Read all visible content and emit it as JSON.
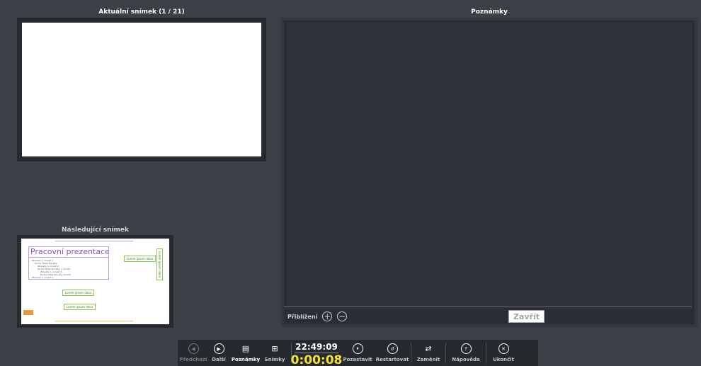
{
  "current_slide": {
    "title": "Aktuální snímek (1 / 21)"
  },
  "next_slide": {
    "title": "Následující snímek",
    "thumb_title": "Pracovní prezentace",
    "thumb_body_lines": [
      "Zkouška ↳ úroveň 1",
      "Druhý řádek zkoušky",
      "Zkouška ↳ úroveň 2",
      "Druhý řádek zkoušky ↳ úroveň",
      "Zkouška ↳ úroveň 3",
      "Druhý řádek zkoušky úroveň",
      "Zkouška ↳ úroveň 1"
    ],
    "callouts": [
      "Lorem ipsum dolor",
      "Lorem ipsum dolor",
      "Lorem ipsum dolor",
      "Lorem ipsum dolor"
    ]
  },
  "notes": {
    "title": "Poznámky",
    "zoom_label": "Přiblížení",
    "zoom_in_symbol": "+",
    "zoom_out_symbol": "−",
    "close_label": "Zavřít"
  },
  "toolbar": {
    "prev": {
      "label": "Předchozí",
      "icon": "◀"
    },
    "next": {
      "label": "Další",
      "icon": "▶"
    },
    "notes": {
      "label": "Poznámky",
      "icon": "▤"
    },
    "slides": {
      "label": "Snímky",
      "icon": "⊞"
    },
    "clock": "22:49:09",
    "timer": "0:00:08",
    "pause": {
      "label": "Pozastavit",
      "icon": "⏸"
    },
    "restart": {
      "label": "Restartovat",
      "icon": "↺"
    },
    "swap": {
      "label": "Zaměnit",
      "icon": "⇄"
    },
    "help": {
      "label": "Nápověda",
      "icon": "?"
    },
    "exit": {
      "label": "Ukončit",
      "icon": "✕"
    }
  },
  "colors": {
    "background": "#3b3f46",
    "timer": "#f3e23a",
    "accent_purple": "#8a4fc0",
    "accent_green": "#8cc64a"
  }
}
